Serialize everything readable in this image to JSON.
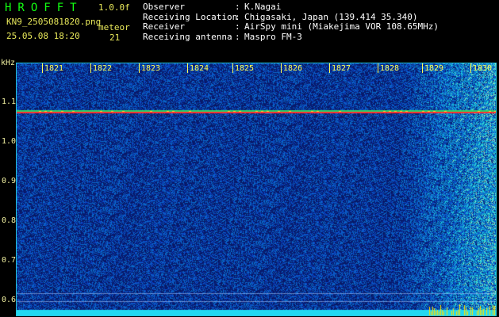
{
  "header": {
    "brand": "HROFFT",
    "version": "1.0.0f",
    "filename": "KN9_2505081820.png",
    "datetime": "25.05.08 18:20",
    "meteor_label": "meteor",
    "meteor_count": "21"
  },
  "station_info": [
    {
      "label": "Observer",
      "value": "K.Nagai"
    },
    {
      "label": "Receiving Location",
      "value": "Chigasaki, Japan (139.414 35.340)"
    },
    {
      "label": "Receiver",
      "value": "AirSpy mini (Miakejima VOR 108.65MHz)"
    },
    {
      "label": "Receiving antenna",
      "value": "Maspro FM-3"
    }
  ],
  "axes": {
    "y_unit": "kHz",
    "y_ticks": [
      "1.1",
      "1.0",
      "0.9",
      "0.8",
      "0.7",
      "0.6"
    ],
    "x_ticks": [
      "1821",
      "1822",
      "1823",
      "1824",
      "1825",
      "1826",
      "1827",
      "1828",
      "1829",
      "1830"
    ]
  },
  "colors": {
    "background": "#000000",
    "noise_base": "#0a1a6e",
    "carrier": "#ff3030",
    "frame": "#22c4e0",
    "tick_text": "#ffff55"
  }
}
